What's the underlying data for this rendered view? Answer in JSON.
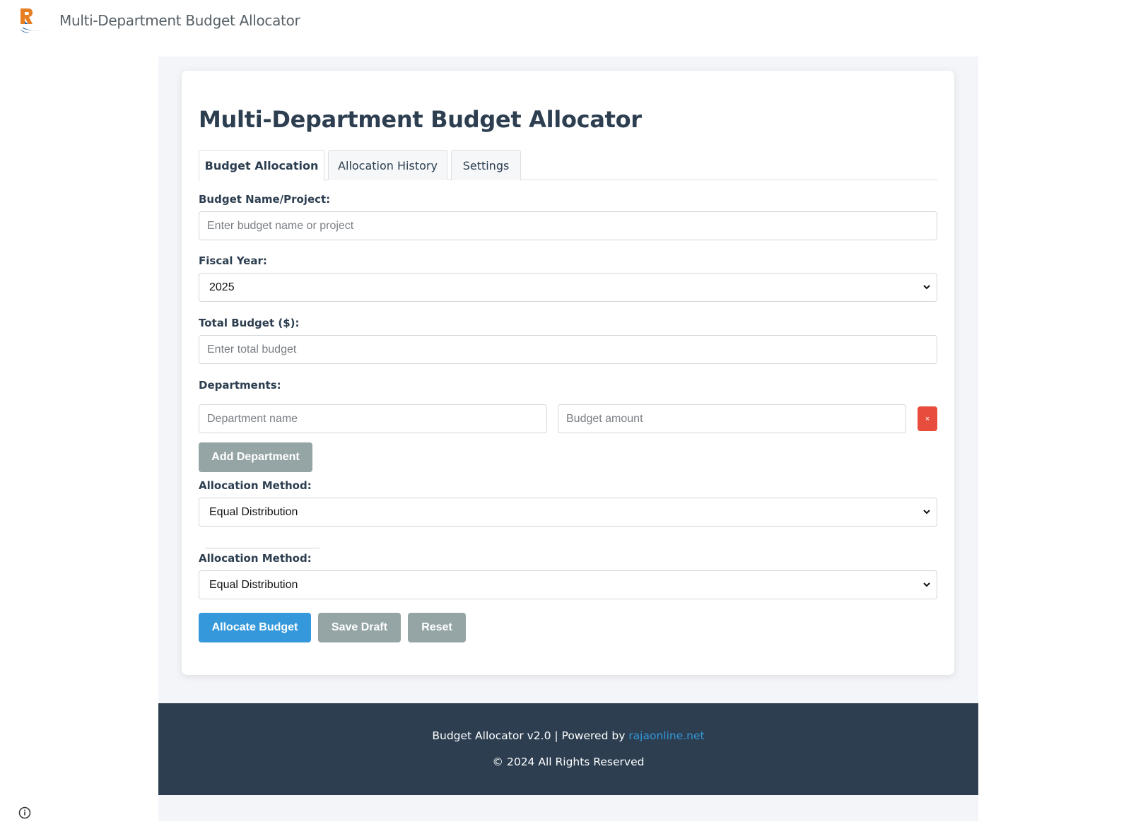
{
  "header": {
    "app_title": "Multi-Department Budget Allocator"
  },
  "main": {
    "title": "Multi-Department Budget Allocator",
    "tabs": [
      {
        "label": "Budget Allocation",
        "active": true
      },
      {
        "label": "Allocation History",
        "active": false
      },
      {
        "label": "Settings",
        "active": false
      }
    ],
    "budget_name": {
      "label": "Budget Name/Project:",
      "placeholder": "Enter budget name or project",
      "value": ""
    },
    "fiscal_year": {
      "label": "Fiscal Year:",
      "value": "2025"
    },
    "total_budget": {
      "label": "Total Budget ($):",
      "placeholder": "Enter total budget",
      "value": ""
    },
    "departments": {
      "label": "Departments:",
      "name_placeholder": "Department name",
      "amount_placeholder": "Budget amount",
      "remove_label": "×",
      "add_label": "Add Department"
    },
    "allocation_method_1": {
      "label": "Allocation Method:",
      "value": "Equal Distribution"
    },
    "allocation_method_2": {
      "label": "Allocation Method:",
      "value": "Equal Distribution"
    },
    "actions": {
      "allocate_label": "Allocate Budget",
      "save_draft_label": "Save Draft",
      "reset_label": "Reset"
    }
  },
  "footer": {
    "version_text": "Budget Allocator v2.0 | Powered by ",
    "link_text": "rajaonline.net",
    "copyright": "© 2024 All Rights Reserved"
  },
  "colors": {
    "primary": "#3498db",
    "secondary": "#95a5a6",
    "danger": "#e74c3c",
    "dark": "#2c3e50"
  },
  "icons": {
    "logo": "app-logo",
    "select_arrow": "chevron-down-icon",
    "info": "info-icon"
  }
}
